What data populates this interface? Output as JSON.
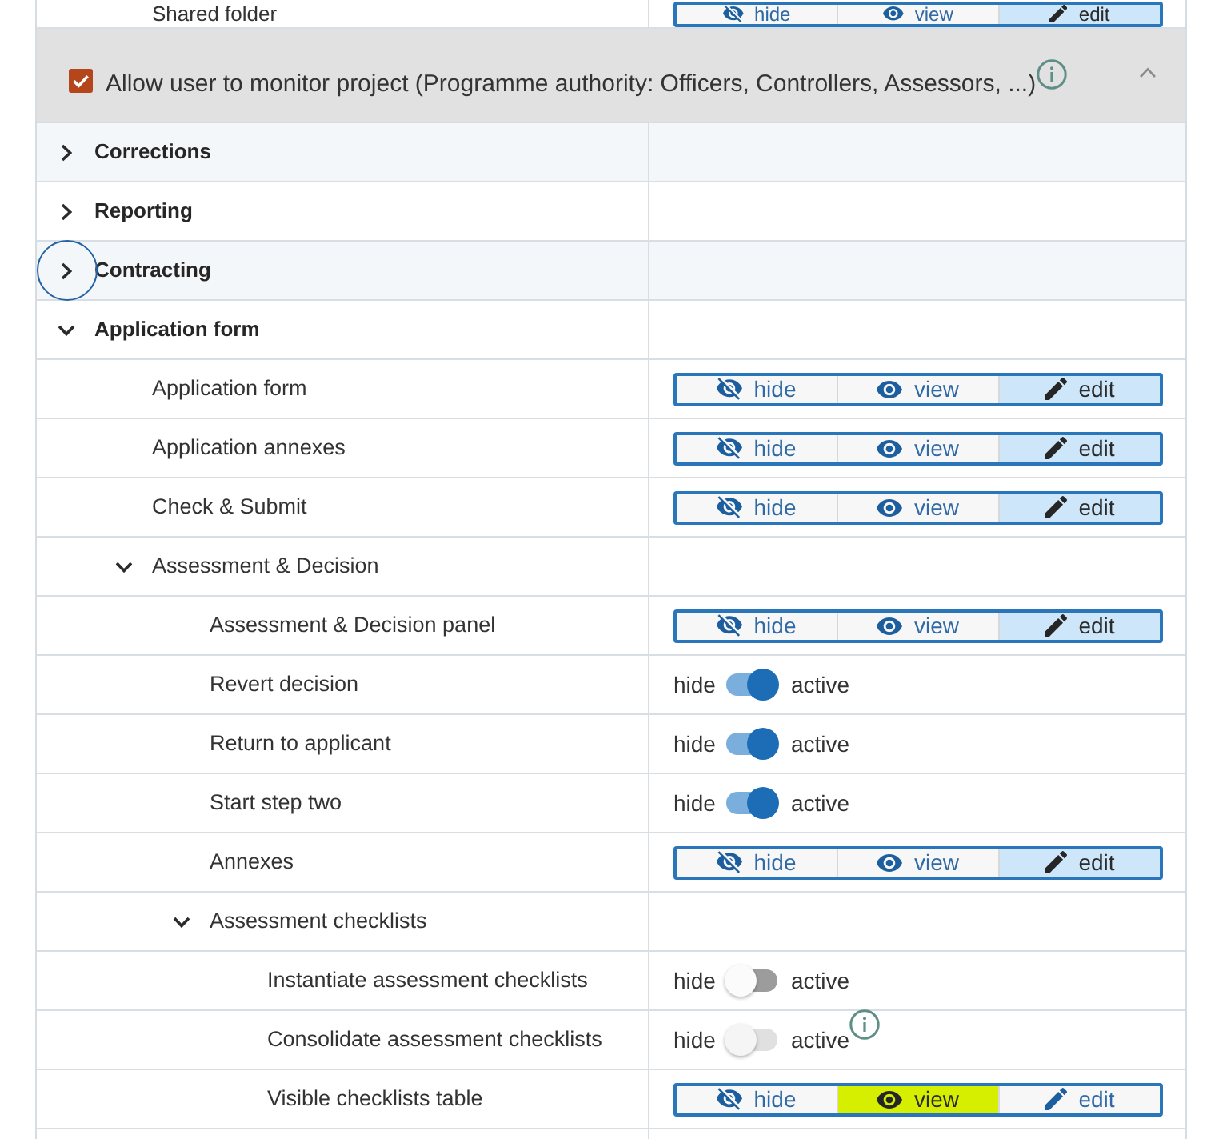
{
  "top_row": {
    "label": "Shared folder",
    "options": [
      {
        "kind": "hide",
        "label": "hide",
        "selected": false
      },
      {
        "kind": "view",
        "label": "view",
        "selected": false
      },
      {
        "kind": "edit",
        "label": "edit",
        "selected": true
      }
    ]
  },
  "section": {
    "label": "Allow user to monitor project (Programme authority: Officers, Controllers, Assessors, ...)",
    "checked": true,
    "info": true,
    "expanded": true
  },
  "tree": [
    {
      "label": "Corrections",
      "kind": "group",
      "expanded": false,
      "focused": false
    },
    {
      "label": "Reporting",
      "kind": "group",
      "expanded": false,
      "focused": false
    },
    {
      "label": "Contracting",
      "kind": "group",
      "expanded": false,
      "focused": true
    },
    {
      "label": "Application form",
      "kind": "group",
      "expanded": true,
      "focused": false,
      "children": [
        {
          "label": "Application form",
          "kind": "access",
          "options": [
            {
              "kind": "hide",
              "label": "hide",
              "selected": false
            },
            {
              "kind": "view",
              "label": "view",
              "selected": false
            },
            {
              "kind": "edit",
              "label": "edit",
              "selected": true
            }
          ]
        },
        {
          "label": "Application annexes",
          "kind": "access",
          "options": [
            {
              "kind": "hide",
              "label": "hide",
              "selected": false
            },
            {
              "kind": "view",
              "label": "view",
              "selected": false
            },
            {
              "kind": "edit",
              "label": "edit",
              "selected": true
            }
          ]
        },
        {
          "label": "Check & Submit",
          "kind": "access",
          "options": [
            {
              "kind": "hide",
              "label": "hide",
              "selected": false
            },
            {
              "kind": "view",
              "label": "view",
              "selected": false
            },
            {
              "kind": "edit",
              "label": "edit",
              "selected": true
            }
          ]
        },
        {
          "label": "Assessment & Decision",
          "kind": "group",
          "expanded": true,
          "children": [
            {
              "label": "Assessment & Decision panel",
              "kind": "access",
              "options": [
                {
                  "kind": "hide",
                  "label": "hide",
                  "selected": false
                },
                {
                  "kind": "view",
                  "label": "view",
                  "selected": false
                },
                {
                  "kind": "edit",
                  "label": "edit",
                  "selected": true
                }
              ]
            },
            {
              "label": "Revert decision",
              "kind": "toggle",
              "off_label": "hide",
              "on_label": "active",
              "on": true,
              "disabled": false,
              "info": false
            },
            {
              "label": "Return to applicant",
              "kind": "toggle",
              "off_label": "hide",
              "on_label": "active",
              "on": true,
              "disabled": false,
              "info": false
            },
            {
              "label": "Start step two",
              "kind": "toggle",
              "off_label": "hide",
              "on_label": "active",
              "on": true,
              "disabled": false,
              "info": false
            },
            {
              "label": "Annexes",
              "kind": "access",
              "options": [
                {
                  "kind": "hide",
                  "label": "hide",
                  "selected": false
                },
                {
                  "kind": "view",
                  "label": "view",
                  "selected": false
                },
                {
                  "kind": "edit",
                  "label": "edit",
                  "selected": true
                }
              ]
            },
            {
              "label": "Assessment checklists",
              "kind": "group",
              "expanded": true,
              "children": [
                {
                  "label": "Instantiate assessment checklists",
                  "kind": "toggle",
                  "off_label": "hide",
                  "on_label": "active",
                  "on": false,
                  "disabled": false,
                  "info": false
                },
                {
                  "label": "Consolidate assessment checklists",
                  "kind": "toggle",
                  "off_label": "hide",
                  "on_label": "active",
                  "on": false,
                  "disabled": true,
                  "info": true
                },
                {
                  "label": "Visible checklists table",
                  "kind": "access",
                  "options": [
                    {
                      "kind": "hide",
                      "label": "hide",
                      "selected": false,
                      "highlighted": false
                    },
                    {
                      "kind": "view",
                      "label": "view",
                      "selected": true,
                      "highlighted": true
                    },
                    {
                      "kind": "edit",
                      "label": "edit",
                      "selected": false,
                      "highlighted": false
                    }
                  ]
                }
              ]
            }
          ]
        }
      ]
    }
  ]
}
